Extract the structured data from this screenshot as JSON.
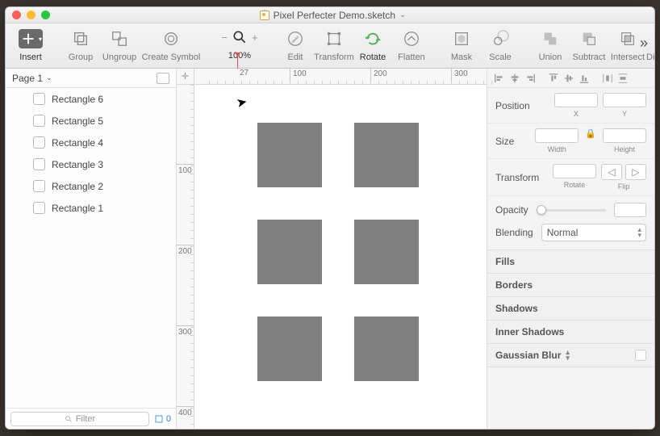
{
  "title": "Pixel Perfecter Demo.sketch",
  "toolbar": {
    "insert": "Insert",
    "group": "Group",
    "ungroup": "Ungroup",
    "create_symbol": "Create Symbol",
    "zoom": "100%",
    "edit": "Edit",
    "transform": "Transform",
    "rotate": "Rotate",
    "flatten": "Flatten",
    "mask": "Mask",
    "scale": "Scale",
    "union": "Union",
    "subtract": "Subtract",
    "intersect": "Intersect",
    "difference": "Difference"
  },
  "pages": {
    "label": "Page 1"
  },
  "layers": [
    {
      "name": "Rectangle 6"
    },
    {
      "name": "Rectangle 5"
    },
    {
      "name": "Rectangle 4"
    },
    {
      "name": "Rectangle 3"
    },
    {
      "name": "Rectangle 2"
    },
    {
      "name": "Rectangle 1"
    }
  ],
  "filter": {
    "placeholder": "Filter",
    "count": "0"
  },
  "ruler": {
    "marker": "27",
    "h": [
      "100",
      "200",
      "300"
    ],
    "v": [
      "100",
      "200",
      "300",
      "400"
    ]
  },
  "inspector": {
    "position": "Position",
    "x": "X",
    "y": "Y",
    "size": "Size",
    "width": "Width",
    "height": "Height",
    "transform": "Transform",
    "rotate": "Rotate",
    "flip": "Flip",
    "opacity": "Opacity",
    "blending": "Blending",
    "blend_mode": "Normal",
    "fills": "Fills",
    "borders": "Borders",
    "shadows": "Shadows",
    "inner_shadows": "Inner Shadows",
    "gaussian_blur": "Gaussian Blur"
  }
}
